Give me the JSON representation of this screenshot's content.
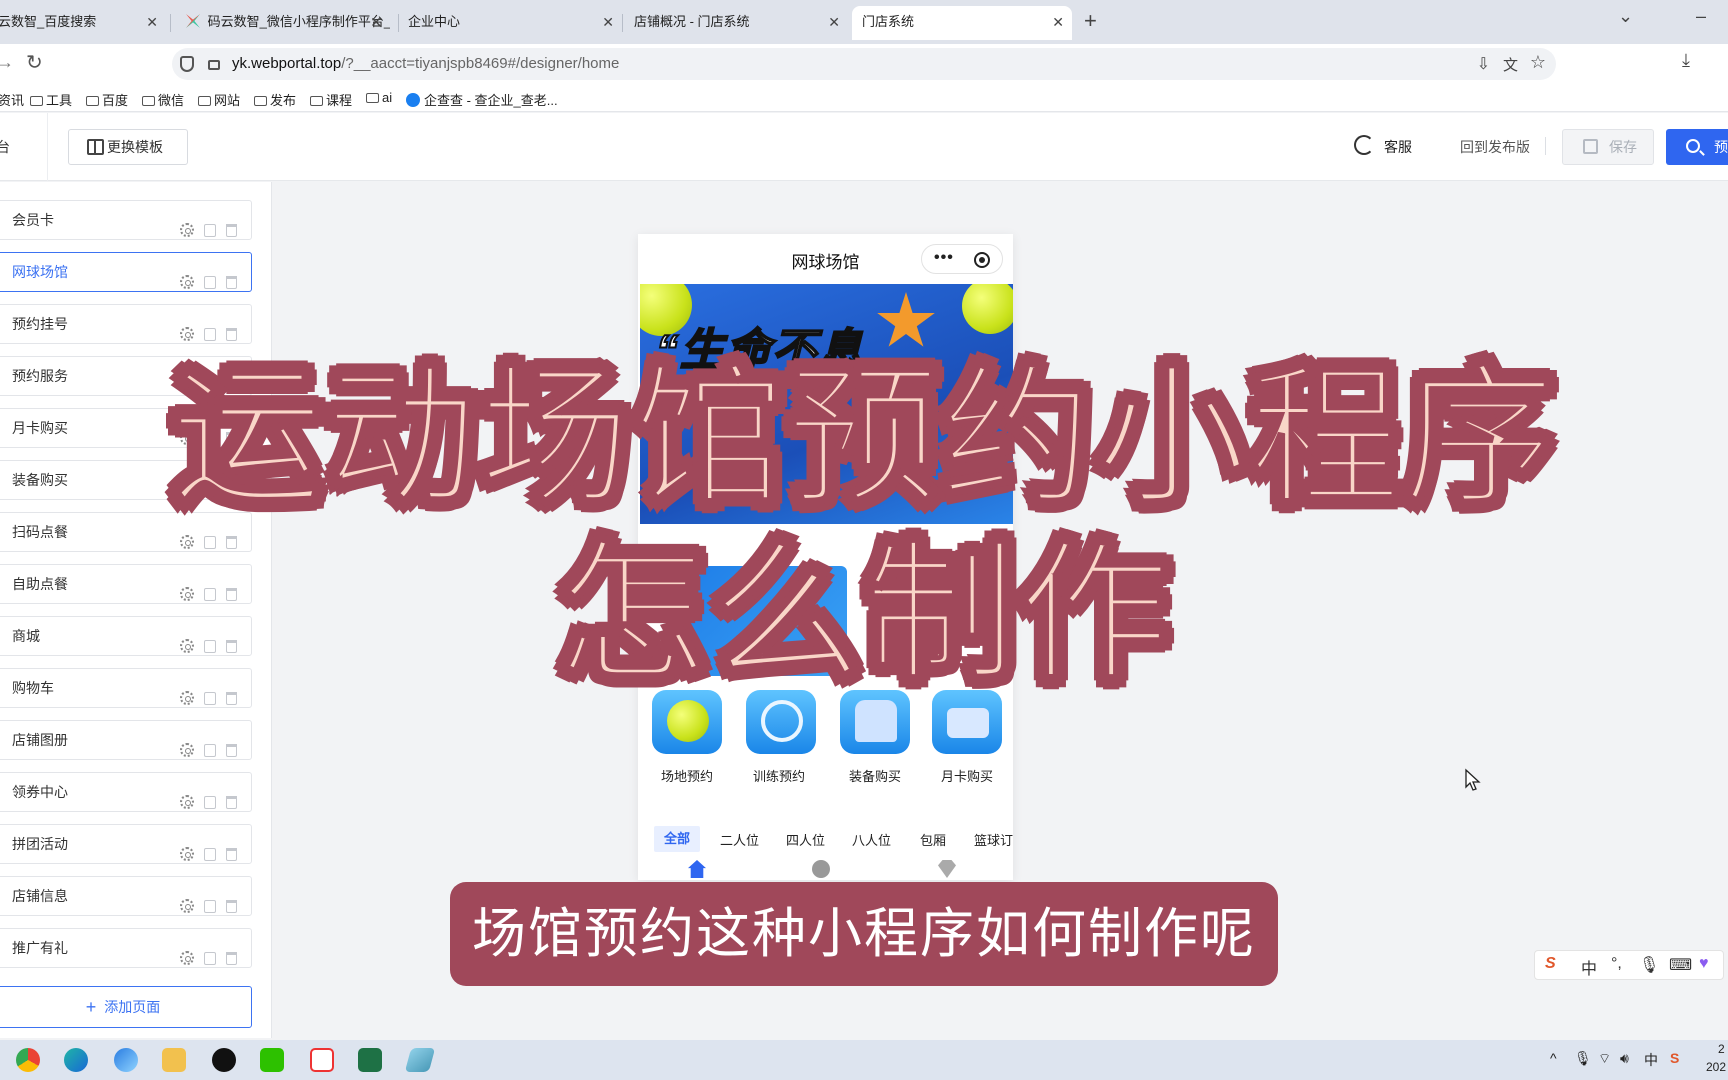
{
  "browser": {
    "tabs": [
      {
        "title": "云数智_百度搜索",
        "active": false
      },
      {
        "title": "码云数智_微信小程序制作平台_",
        "active": false
      },
      {
        "title": "企业中心",
        "active": false
      },
      {
        "title": "店铺概况 - 门店系统",
        "active": false
      },
      {
        "title": "门店系统",
        "active": true
      }
    ],
    "url_host": "yk.webportal.top",
    "url_path": "/?__aacct=tiyanjspb8469#/designer/home",
    "bookmarks": [
      "资讯",
      "工具",
      "百度",
      "微信",
      "网站",
      "发布",
      "课程",
      "ai",
      "企查查 - 查企业_查老..."
    ]
  },
  "header": {
    "left_fragment": "台",
    "template_button": "更换模板",
    "customer_service": "客服",
    "revert": "回到发布版",
    "save": "保存",
    "preview": "预"
  },
  "sidebar": {
    "pages": [
      {
        "label": "会员卡",
        "active": false
      },
      {
        "label": "网球场馆",
        "active": true
      },
      {
        "label": "预约挂号",
        "active": false
      },
      {
        "label": "预约服务",
        "active": false
      },
      {
        "label": "月卡购买",
        "active": false
      },
      {
        "label": "装备购买",
        "active": false
      },
      {
        "label": "扫码点餐",
        "active": false
      },
      {
        "label": "自助点餐",
        "active": false
      },
      {
        "label": "商城",
        "active": false
      },
      {
        "label": "购物车",
        "active": false
      },
      {
        "label": "店铺图册",
        "active": false
      },
      {
        "label": "领券中心",
        "active": false
      },
      {
        "label": "拼团活动",
        "active": false
      },
      {
        "label": "店铺信息",
        "active": false
      },
      {
        "label": "推广有礼",
        "active": false
      }
    ],
    "add_page": "添加页面"
  },
  "phone": {
    "title": "网球场馆",
    "banner_slogan": "“生命不息",
    "quick_entries": [
      "场地预约",
      "训练预约",
      "装备购买",
      "月卡购买"
    ],
    "categories": [
      "全部",
      "二人位",
      "四人位",
      "八人位",
      "包厢",
      "篮球订"
    ],
    "active_category": "全部"
  },
  "overlay": {
    "title_line1": "运动场馆预约小程序",
    "title_line2": "怎么制作",
    "subtitle": "场馆预约这种小程序如何制作呢"
  },
  "ime": {
    "lang": "中"
  },
  "taskbar": {
    "tray_lang": "中",
    "clock_top": "2",
    "clock_bottom": "202"
  },
  "colors": {
    "accent": "#2f66f0",
    "overlay_fill": "#f9d6c8",
    "overlay_stroke": "#a0485a"
  }
}
